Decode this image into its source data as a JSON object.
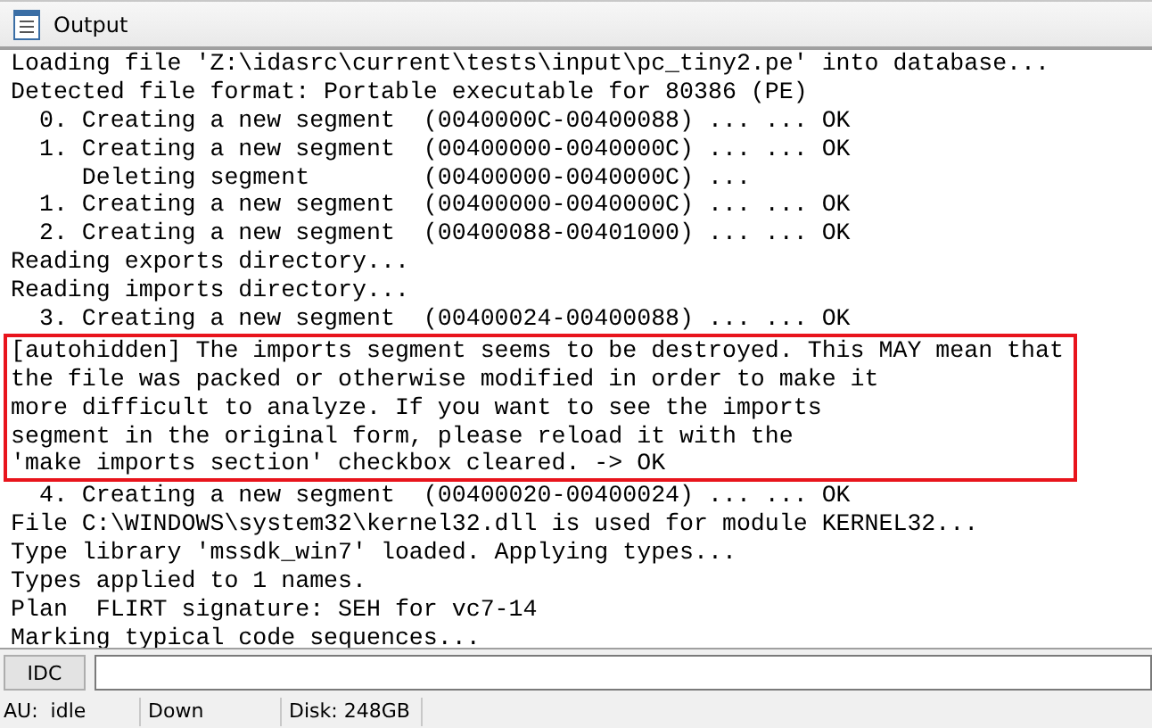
{
  "window": {
    "title": "Output"
  },
  "log": [
    {
      "kind": "line",
      "text": "Loading file 'Z:\\idasrc\\current\\tests\\input\\pc_tiny2.pe' into database..."
    },
    {
      "kind": "line",
      "text": "Detected file format: Portable executable for 80386 (PE)"
    },
    {
      "kind": "line",
      "text": "  0. Creating a new segment  (0040000C-00400088) ... ... OK"
    },
    {
      "kind": "line",
      "text": "  1. Creating a new segment  (00400000-0040000C) ... ... OK"
    },
    {
      "kind": "line",
      "text": "     Deleting segment        (00400000-0040000C) ..."
    },
    {
      "kind": "line",
      "text": "  1. Creating a new segment  (00400000-0040000C) ... ... OK"
    },
    {
      "kind": "line",
      "text": "  2. Creating a new segment  (00400088-00401000) ... ... OK"
    },
    {
      "kind": "line",
      "text": "Reading exports directory..."
    },
    {
      "kind": "line",
      "text": "Reading imports directory..."
    },
    {
      "kind": "line",
      "text": "  3. Creating a new segment  (00400024-00400088) ... ... OK"
    },
    {
      "kind": "highlight",
      "lines": [
        "[autohidden] The imports segment seems to be destroyed. This MAY mean that",
        "the file was packed or otherwise modified in order to make it",
        "more difficult to analyze. If you want to see the imports",
        "segment in the original form, please reload it with the",
        "'make imports section' checkbox cleared. -> OK"
      ]
    },
    {
      "kind": "line",
      "text": "  4. Creating a new segment  (00400020-00400024) ... ... OK"
    },
    {
      "kind": "line",
      "text": "File C:\\WINDOWS\\system32\\kernel32.dll is used for module KERNEL32..."
    },
    {
      "kind": "line",
      "text": "Type library 'mssdk_win7' loaded. Applying types..."
    },
    {
      "kind": "line",
      "text": "Types applied to 1 names."
    },
    {
      "kind": "line",
      "text": "Plan  FLIRT signature: SEH for vc7-14"
    },
    {
      "kind": "line",
      "text": "Marking typical code sequences..."
    }
  ],
  "command": {
    "button": "IDC"
  },
  "status_bar": [
    "AU:  idle",
    "Down",
    "Disk: 248GB"
  ]
}
